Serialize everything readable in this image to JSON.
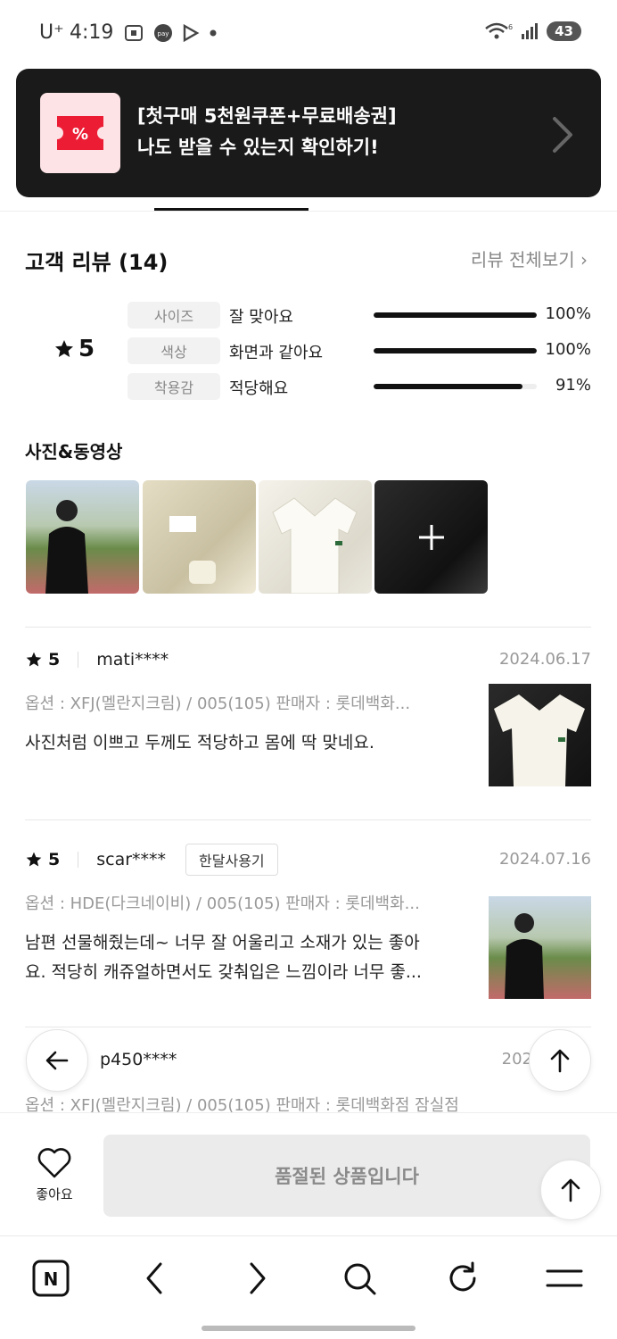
{
  "status_bar": {
    "carrier": "U⁺",
    "time": "4:19",
    "battery": "43"
  },
  "promo": {
    "line1": "[첫구매 5천원쿠폰+무료배송권]",
    "line2": "나도 받을 수 있는지 확인하기!",
    "badge_symbol": "%"
  },
  "reviews": {
    "title": "고객 리뷰 (14)",
    "see_all": "리뷰 전체보기 ›",
    "rating": "5",
    "attributes": [
      {
        "label": "사이즈",
        "value": "잘 맞아요",
        "percent_text": "100%",
        "percent": 100
      },
      {
        "label": "색상",
        "value": "화면과 같아요",
        "percent_text": "100%",
        "percent": 100
      },
      {
        "label": "착용감",
        "value": "적당해요",
        "percent_text": "91%",
        "percent": 91
      }
    ],
    "media_title": "사진&동영상",
    "items": [
      {
        "score": "5",
        "user": "mati****",
        "tag": "",
        "date": "2024.06.17",
        "option": "옵션 : XFJ(멜란지크림) / 005(105)   판매자 : 롯데백화...",
        "body": "사진처럼 이쁘고 두께도 적당하고 몸에 딱 맞네요."
      },
      {
        "score": "5",
        "user": "scar****",
        "tag": "한달사용기",
        "date": "2024.07.16",
        "option": "옵션 : HDE(다크네이비) / 005(105)   판매자 : 롯데백화...",
        "body_line1": "남편 선물해줬는데~ 너무 잘 어울리고 소재가 있는 좋아",
        "body_line2": "요. 적당히 캐쥬얼하면서도 갖춰입은 느낌이라 너무 좋..."
      },
      {
        "user": "p450****",
        "date": "202",
        "option": "옵션 : XFJ(멜란지크림) / 005(105)   판매자 : 롯데백화점 잠실점"
      }
    ]
  },
  "action_bar": {
    "like_label": "좋아요",
    "soldout_label": "품절된 상품입니다"
  },
  "browser_nav": {
    "logo_letter": "N"
  },
  "icons": [
    "heart-icon",
    "back-arrow-icon",
    "scroll-top-icon",
    "search-icon",
    "refresh-icon",
    "menu-icon",
    "plus-icon",
    "star-icon",
    "chevron-right-icon"
  ]
}
